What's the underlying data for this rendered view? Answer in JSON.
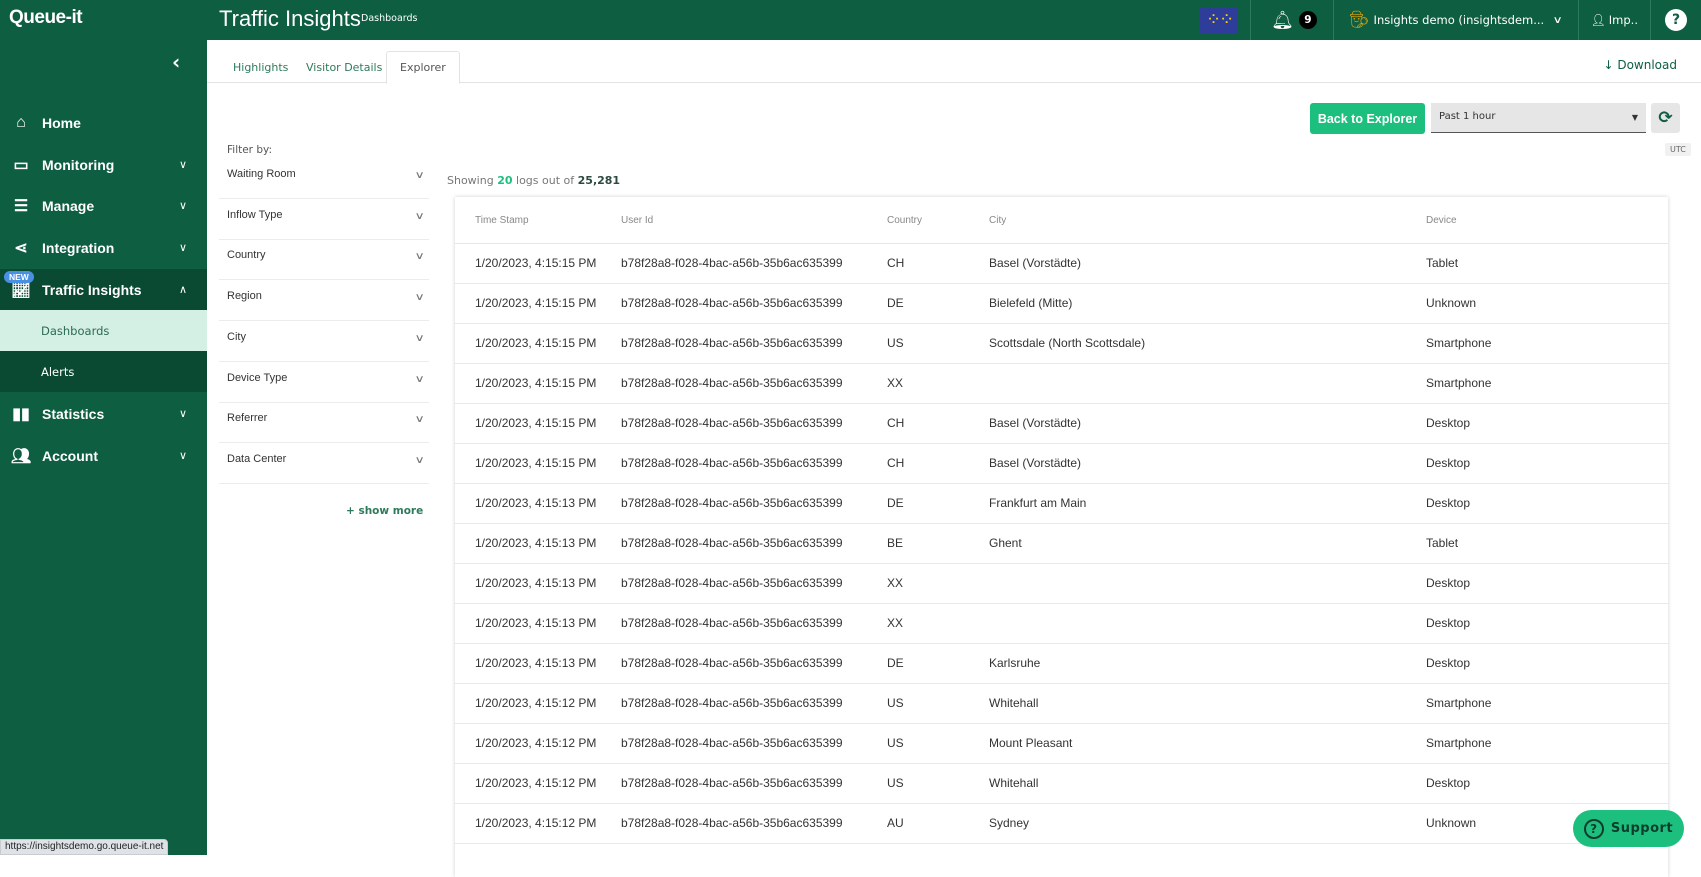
{
  "topbar": {
    "logo": "Queue-it",
    "title": "Traffic Insights",
    "subtitle": "Dashboards",
    "notifications_count": "9",
    "account_label": "Insights demo (insightsdem...",
    "impersonate_label": "Imp..",
    "help_label": "?"
  },
  "sidebar": {
    "collapse_icon": "‹",
    "items": [
      {
        "label": "Home",
        "icon": "home-icon"
      },
      {
        "label": "Monitoring",
        "icon": "monitor-icon"
      },
      {
        "label": "Manage",
        "icon": "list-icon"
      },
      {
        "label": "Integration",
        "icon": "integration-icon"
      },
      {
        "label": "Traffic Insights",
        "icon": "chart-line-icon",
        "badge": "NEW"
      },
      {
        "label": "Statistics",
        "icon": "bar-chart-icon"
      },
      {
        "label": "Account",
        "icon": "users-icon"
      }
    ],
    "subitems": [
      {
        "label": "Dashboards"
      },
      {
        "label": "Alerts"
      }
    ]
  },
  "tabs": [
    {
      "label": "Highlights"
    },
    {
      "label": "Visitor Details"
    },
    {
      "label": "Explorer",
      "active": true
    }
  ],
  "download_label": "Download",
  "toolbar": {
    "back_label": "Back to Explorer",
    "time_range": "Past 1 hour",
    "timezone": "UTC"
  },
  "filters": {
    "label": "Filter by:",
    "items": [
      "Waiting Room",
      "Inflow Type",
      "Country",
      "Region",
      "City",
      "Device Type",
      "Referrer",
      "Data Center"
    ],
    "show_more": "+ show more"
  },
  "summary": {
    "prefix": "Showing",
    "shown": "20",
    "middle": "logs out of",
    "total": "25,281"
  },
  "table": {
    "columns": [
      "Time Stamp",
      "User Id",
      "Country",
      "City",
      "Device"
    ],
    "rows": [
      [
        "1/20/2023, 4:15:15 PM",
        "b78f28a8-f028-4bac-a56b-35b6ac635399",
        "CH",
        "Basel (Vorstädte)",
        "Tablet"
      ],
      [
        "1/20/2023, 4:15:15 PM",
        "b78f28a8-f028-4bac-a56b-35b6ac635399",
        "DE",
        "Bielefeld (Mitte)",
        "Unknown"
      ],
      [
        "1/20/2023, 4:15:15 PM",
        "b78f28a8-f028-4bac-a56b-35b6ac635399",
        "US",
        "Scottsdale (North Scottsdale)",
        "Smartphone"
      ],
      [
        "1/20/2023, 4:15:15 PM",
        "b78f28a8-f028-4bac-a56b-35b6ac635399",
        "XX",
        "",
        "Smartphone"
      ],
      [
        "1/20/2023, 4:15:15 PM",
        "b78f28a8-f028-4bac-a56b-35b6ac635399",
        "CH",
        "Basel (Vorstädte)",
        "Desktop"
      ],
      [
        "1/20/2023, 4:15:15 PM",
        "b78f28a8-f028-4bac-a56b-35b6ac635399",
        "CH",
        "Basel (Vorstädte)",
        "Desktop"
      ],
      [
        "1/20/2023, 4:15:13 PM",
        "b78f28a8-f028-4bac-a56b-35b6ac635399",
        "DE",
        "Frankfurt am Main",
        "Desktop"
      ],
      [
        "1/20/2023, 4:15:13 PM",
        "b78f28a8-f028-4bac-a56b-35b6ac635399",
        "BE",
        "Ghent",
        "Tablet"
      ],
      [
        "1/20/2023, 4:15:13 PM",
        "b78f28a8-f028-4bac-a56b-35b6ac635399",
        "XX",
        "",
        "Desktop"
      ],
      [
        "1/20/2023, 4:15:13 PM",
        "b78f28a8-f028-4bac-a56b-35b6ac635399",
        "XX",
        "",
        "Desktop"
      ],
      [
        "1/20/2023, 4:15:13 PM",
        "b78f28a8-f028-4bac-a56b-35b6ac635399",
        "DE",
        "Karlsruhe",
        "Desktop"
      ],
      [
        "1/20/2023, 4:15:12 PM",
        "b78f28a8-f028-4bac-a56b-35b6ac635399",
        "US",
        "Whitehall",
        "Smartphone"
      ],
      [
        "1/20/2023, 4:15:12 PM",
        "b78f28a8-f028-4bac-a56b-35b6ac635399",
        "US",
        "Mount Pleasant",
        "Smartphone"
      ],
      [
        "1/20/2023, 4:15:12 PM",
        "b78f28a8-f028-4bac-a56b-35b6ac635399",
        "US",
        "Whitehall",
        "Desktop"
      ],
      [
        "1/20/2023, 4:15:12 PM",
        "b78f28a8-f028-4bac-a56b-35b6ac635399",
        "AU",
        "Sydney",
        "Unknown"
      ]
    ]
  },
  "support_label": "Support",
  "status_url": "https://insightsdemo.go.queue-it.net",
  "colors": {
    "brand": "#0e5e42",
    "accent": "#1dbf7e",
    "sidebar_active_sub": "#d4f0e4"
  }
}
